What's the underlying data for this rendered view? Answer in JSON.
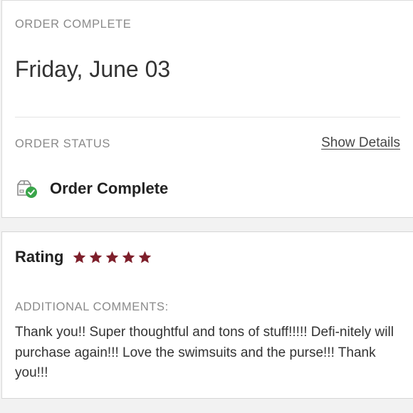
{
  "order": {
    "section_label": "ORDER COMPLETE",
    "date": "Friday, June 03"
  },
  "status": {
    "section_label": "ORDER STATUS",
    "show_details_label": "Show Details",
    "value": "Order Complete",
    "icon": "package-check-icon",
    "icon_check_color": "#3aa54a"
  },
  "rating": {
    "label": "Rating",
    "stars": 5,
    "max_stars": 5,
    "star_color": "#7e1f2b"
  },
  "comments": {
    "section_label": "ADDITIONAL COMMENTS:",
    "text": "Thank you!! Super thoughtful and tons of stuff!!!!! Defi-nitely will purchase again!!! Love the swimsuits and the purse!!! Thank you!!!"
  }
}
